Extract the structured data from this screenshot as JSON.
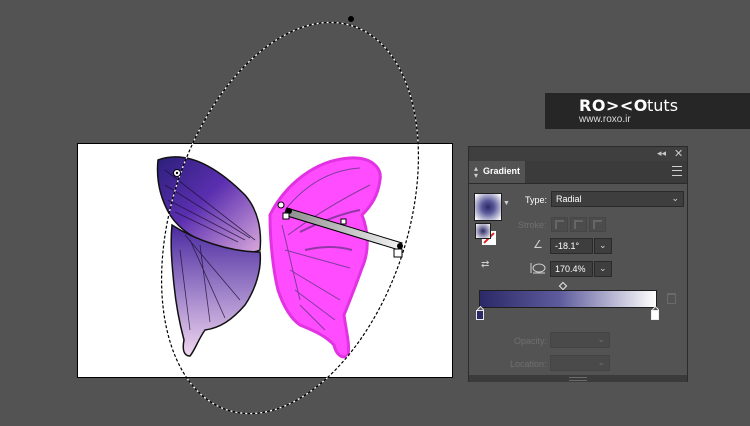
{
  "watermark": {
    "logo": "RO><O",
    "tuts": "tuts",
    "url": "www.roxo.ir"
  },
  "gradient_panel": {
    "tab_label": "Gradient",
    "type_label": "Type:",
    "type_value": "Radial",
    "stroke_label": "Stroke:",
    "angle_value": "-18.1°",
    "aspect_value": "170.4%",
    "opacity_label": "Opacity:",
    "location_label": "Location:",
    "start_color": "#2c2968",
    "end_color": "#ffffff"
  },
  "colors": {
    "background": "#535353",
    "panel": "#535353",
    "artboard": "#ffffff",
    "butterfly_left_dark": "#2c2968",
    "butterfly_left_light": "#c79ad8",
    "butterfly_right_highlight": "#ff44ff"
  },
  "icons": {
    "collapse": "collapse-icon",
    "close": "close-icon",
    "menu": "menu-icon",
    "angle": "angle-icon",
    "aspect": "aspect-ratio-icon",
    "reverse": "reverse-gradient-icon",
    "trash": "trash-icon"
  }
}
